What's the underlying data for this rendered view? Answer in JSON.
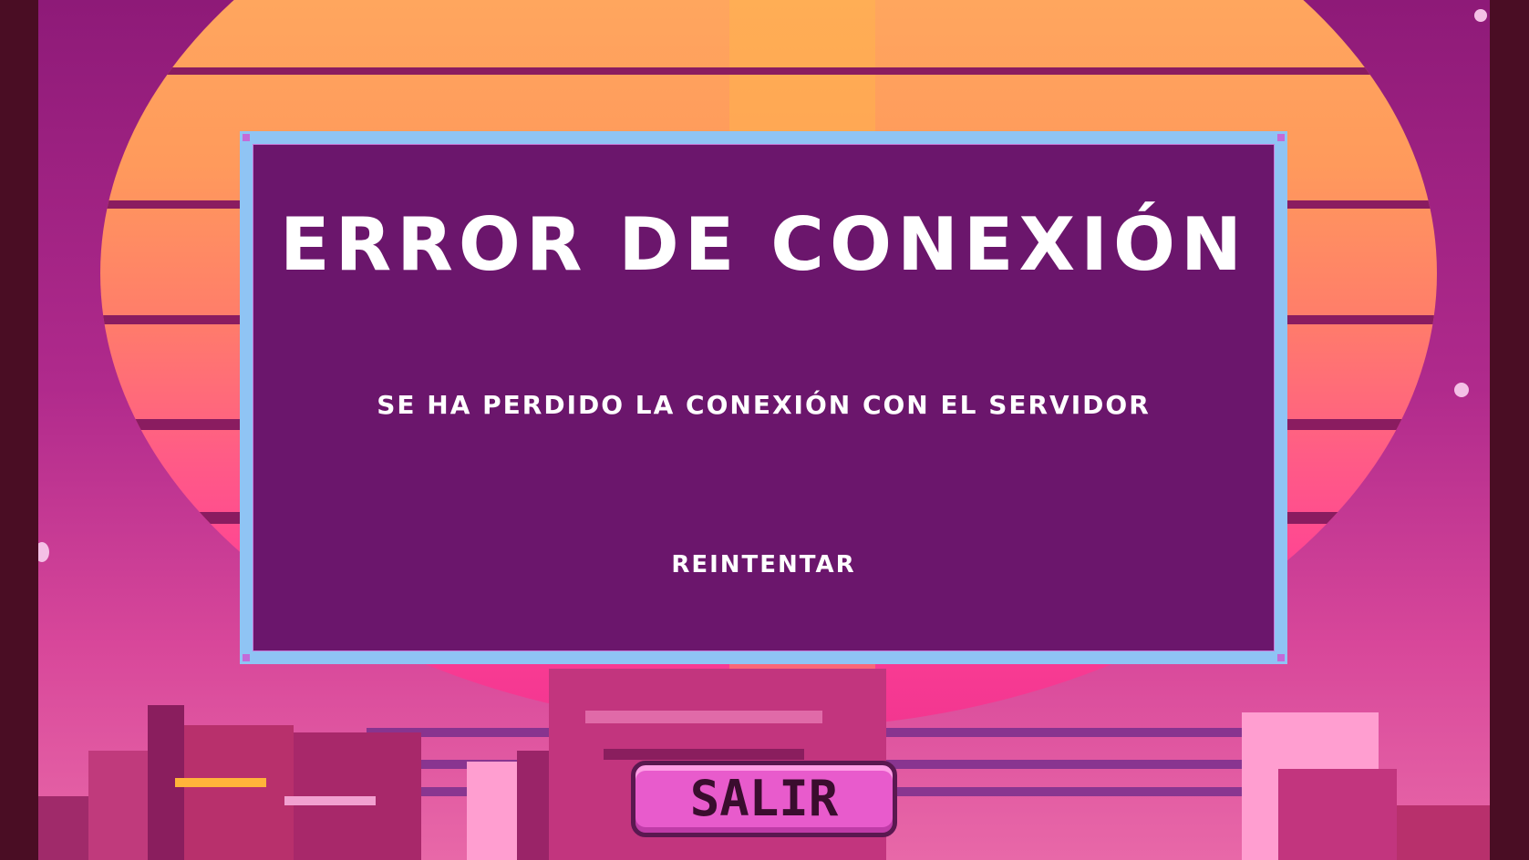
{
  "dialog": {
    "title": "ERROR DE CONEXIÓN",
    "message": "SE HA PERDIDO LA CONEXIÓN CON EL SERVIDOR",
    "retry_label": "REINTENTAR"
  },
  "exit_label": "SALIR",
  "colors": {
    "dialog_bg": "#6b166c",
    "dialog_border": "#8fc4f4",
    "sun_top": "#ffa75a",
    "sun_bottom": "#f23690",
    "exit_button": "#e85bcc",
    "letterbox": "#4a0d24"
  }
}
